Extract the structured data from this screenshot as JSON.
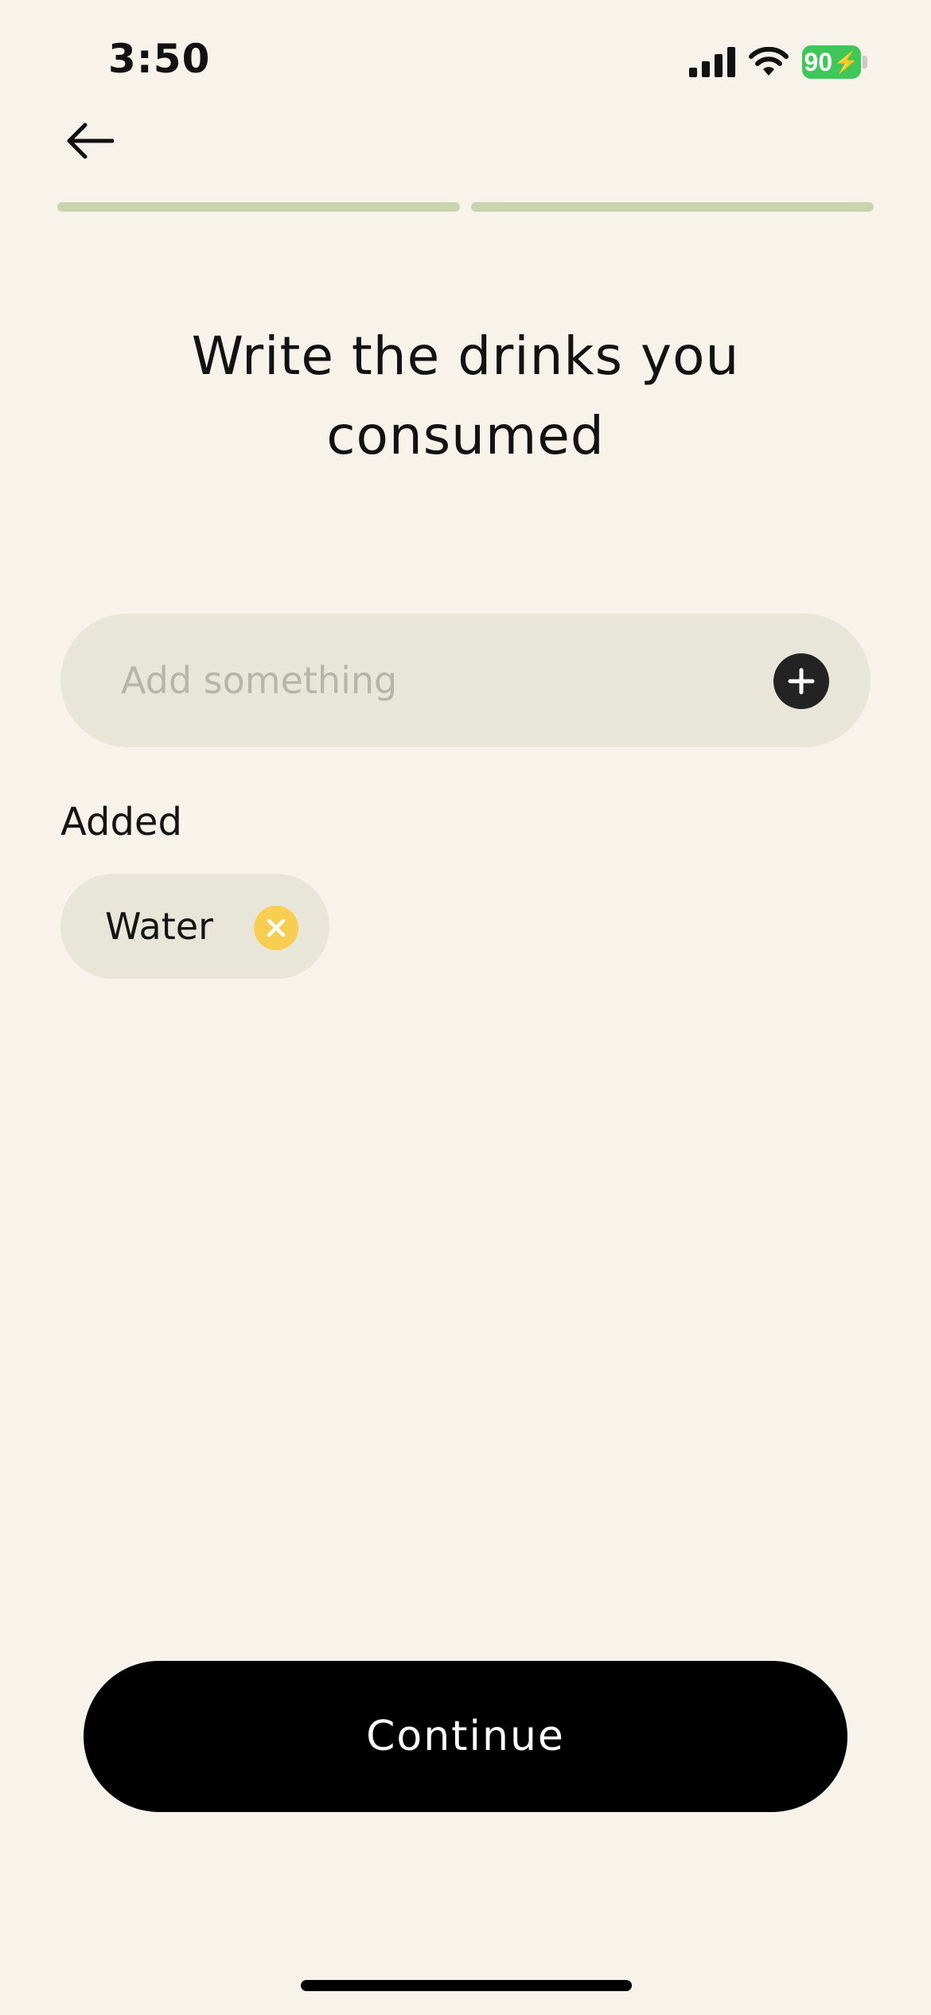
{
  "status_bar": {
    "time": "3:50",
    "battery_percent": "90",
    "battery_color": "#40c759",
    "icons": [
      "signal-icon",
      "wifi-icon",
      "battery-icon",
      "charging-bolt-icon"
    ]
  },
  "nav": {
    "back_icon": "arrow-left-icon"
  },
  "progress": {
    "total_steps": 2,
    "completed_steps": 2,
    "color": "#c9d4ae"
  },
  "page": {
    "title": "Write the drinks you consumed"
  },
  "input": {
    "value": "",
    "placeholder": "Add something",
    "add_icon": "plus-icon"
  },
  "added": {
    "label": "Added",
    "items": [
      {
        "label": "Water",
        "remove_icon": "close-icon",
        "remove_color": "#f7ce4f"
      }
    ]
  },
  "actions": {
    "continue_label": "Continue"
  },
  "colors": {
    "background": "#f7f2ea",
    "field": "#e8e6d9",
    "primary_button": "#000000"
  }
}
